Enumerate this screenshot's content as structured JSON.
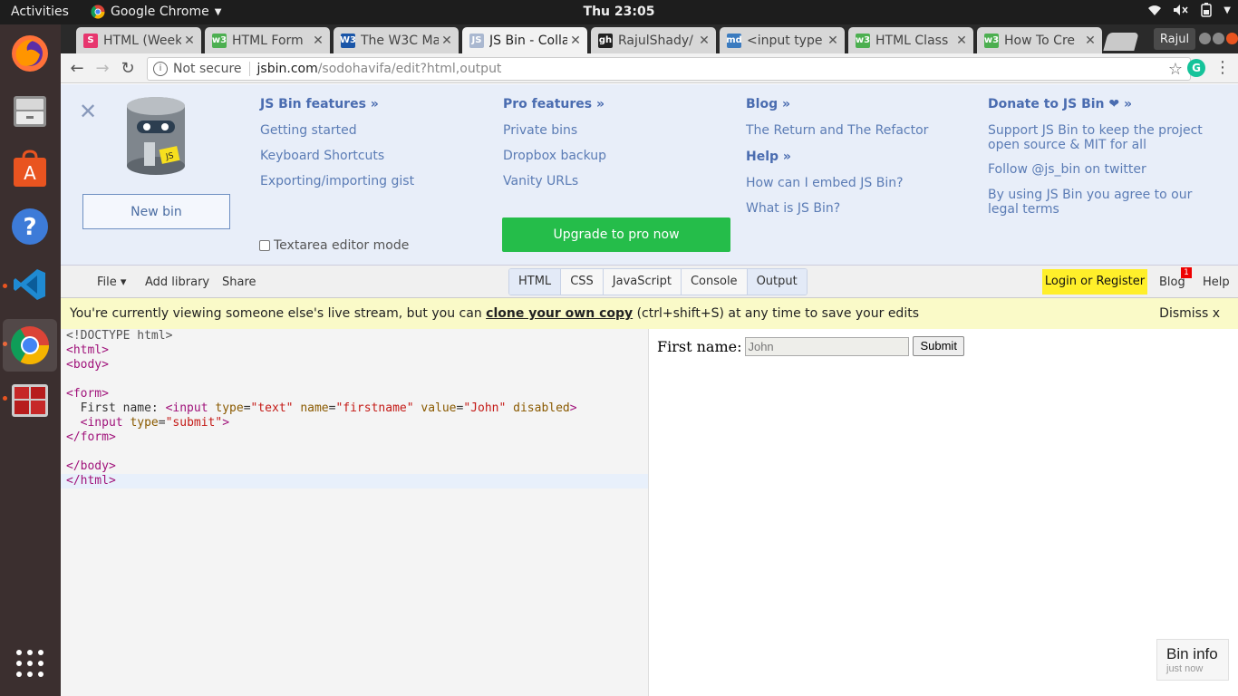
{
  "topbar": {
    "activities": "Activities",
    "app_name": "Google Chrome",
    "clock": "Thu 23:05"
  },
  "dock": {
    "apps": [
      "firefox-icon",
      "files-icon",
      "software-center-icon",
      "help-icon",
      "vscode-icon",
      "chrome-icon",
      "terminal-icon"
    ],
    "show_apps": "apps-grid-icon"
  },
  "browser": {
    "tabs": [
      {
        "title": "HTML (Week",
        "favicon": "S",
        "color": "#e7366e"
      },
      {
        "title": "HTML Form",
        "favicon": "w3",
        "color": "#4caf50"
      },
      {
        "title": "The W3C Ma",
        "favicon": "W3",
        "color": "#1a56a8"
      },
      {
        "title": "JS Bin - Colla",
        "favicon": "JS",
        "color": "#aab8d0"
      },
      {
        "title": "RajulShady/",
        "favicon": "gh",
        "color": "#222222"
      },
      {
        "title": "<input type",
        "favicon": "md",
        "color": "#3b7bbf"
      },
      {
        "title": "HTML Class",
        "favicon": "w3",
        "color": "#4caf50"
      },
      {
        "title": "How To Cre",
        "favicon": "w3",
        "color": "#4caf50"
      }
    ],
    "profile": "Rajul",
    "security": "Not secure",
    "url_host": "jsbin.com",
    "url_path": "/sodohavifa/edit?html,output"
  },
  "panel": {
    "new_bin": "New bin",
    "textarea_mode": "Textarea editor mode",
    "upgrade": "Upgrade to pro now",
    "features_head": "JS Bin features »",
    "features": [
      "Getting started",
      "Keyboard Shortcuts",
      "Exporting/importing gist"
    ],
    "pro_head": "Pro features »",
    "pro": [
      "Private bins",
      "Dropbox backup",
      "Vanity URLs"
    ],
    "blog_head": "Blog »",
    "blog": [
      "The Return and The Refactor"
    ],
    "help_head": "Help »",
    "help": [
      "How can I embed JS Bin?",
      "What is JS Bin?"
    ],
    "donate_head": "Donate to JS Bin ❤ »",
    "donate": [
      "Support JS Bin to keep the project open source & MIT for all",
      "Follow @js_bin on twitter",
      "By using JS Bin you agree to our legal terms"
    ]
  },
  "jsbin_toolbar": {
    "file": "File ▾",
    "add_library": "Add library",
    "share": "Share",
    "panels": [
      "HTML",
      "CSS",
      "JavaScript",
      "Console",
      "Output"
    ],
    "login": "Login or Register",
    "blog": "Blog",
    "blog_badge": "1",
    "help": "Help"
  },
  "notice": {
    "pre": "You're currently viewing someone else's live stream, but you can ",
    "link": "clone your own copy",
    "post": " (ctrl+shift+S) at any time to save your edits",
    "dismiss": "Dismiss x"
  },
  "output": {
    "label": "First name:",
    "input_value": "John",
    "submit": "Submit"
  },
  "bin_info": {
    "title": "Bin info",
    "subtitle": "just now"
  }
}
